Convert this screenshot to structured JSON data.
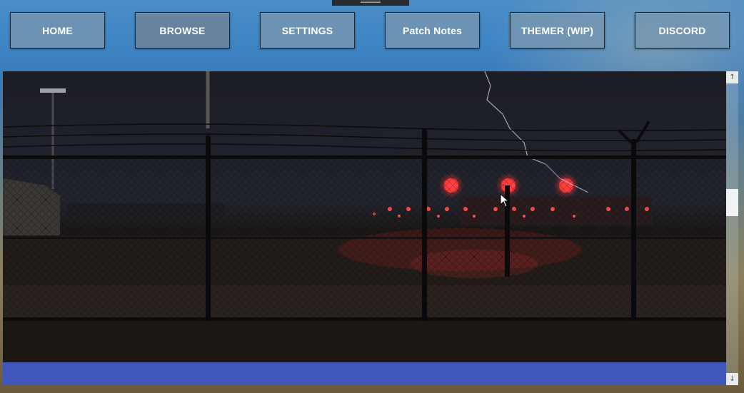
{
  "nav": {
    "items": [
      {
        "label": "HOME"
      },
      {
        "label": "BROWSE"
      },
      {
        "label": "SETTINGS"
      },
      {
        "label": "Patch Notes"
      },
      {
        "label": "THEMER (WIP)"
      },
      {
        "label": "DISCORD"
      }
    ]
  },
  "icons": {
    "scroll_up": "arrow-up-icon",
    "scroll_down": "arrow-down-icon",
    "drag": "drag-handle-icon"
  },
  "colors": {
    "accent_strip": "#3f57b9",
    "nav_button": "#7896af"
  }
}
